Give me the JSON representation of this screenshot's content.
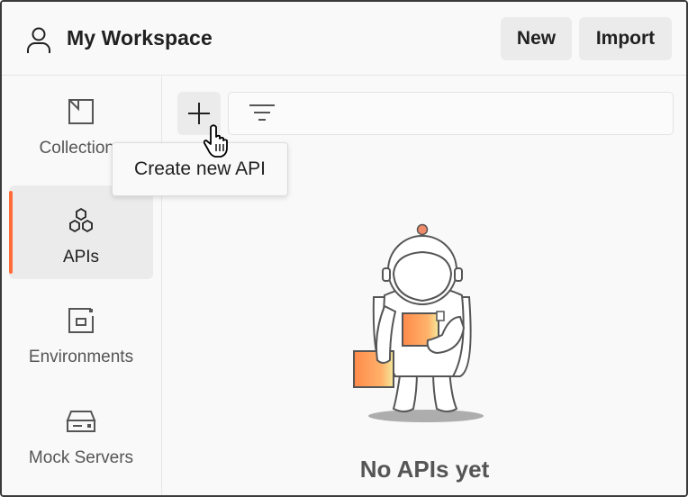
{
  "header": {
    "workspace_title": "My Workspace",
    "new_label": "New",
    "import_label": "Import",
    "workspace_icon": "user-icon"
  },
  "sidebar": {
    "items": [
      {
        "label": "Collections",
        "icon": "collection-icon",
        "active": false
      },
      {
        "label": "APIs",
        "icon": "apis-icon",
        "active": true
      },
      {
        "label": "Environments",
        "icon": "environment-icon",
        "active": false
      },
      {
        "label": "Mock Servers",
        "icon": "mock-server-icon",
        "active": false
      }
    ]
  },
  "main": {
    "create_button_icon": "plus-icon",
    "filter_icon": "filter-icon",
    "tooltip_text": "Create new API",
    "empty_title": "No APIs yet"
  },
  "colors": {
    "accent": "#ff6c37",
    "background": "#f9f9f9",
    "button_bg": "#ebebeb"
  }
}
